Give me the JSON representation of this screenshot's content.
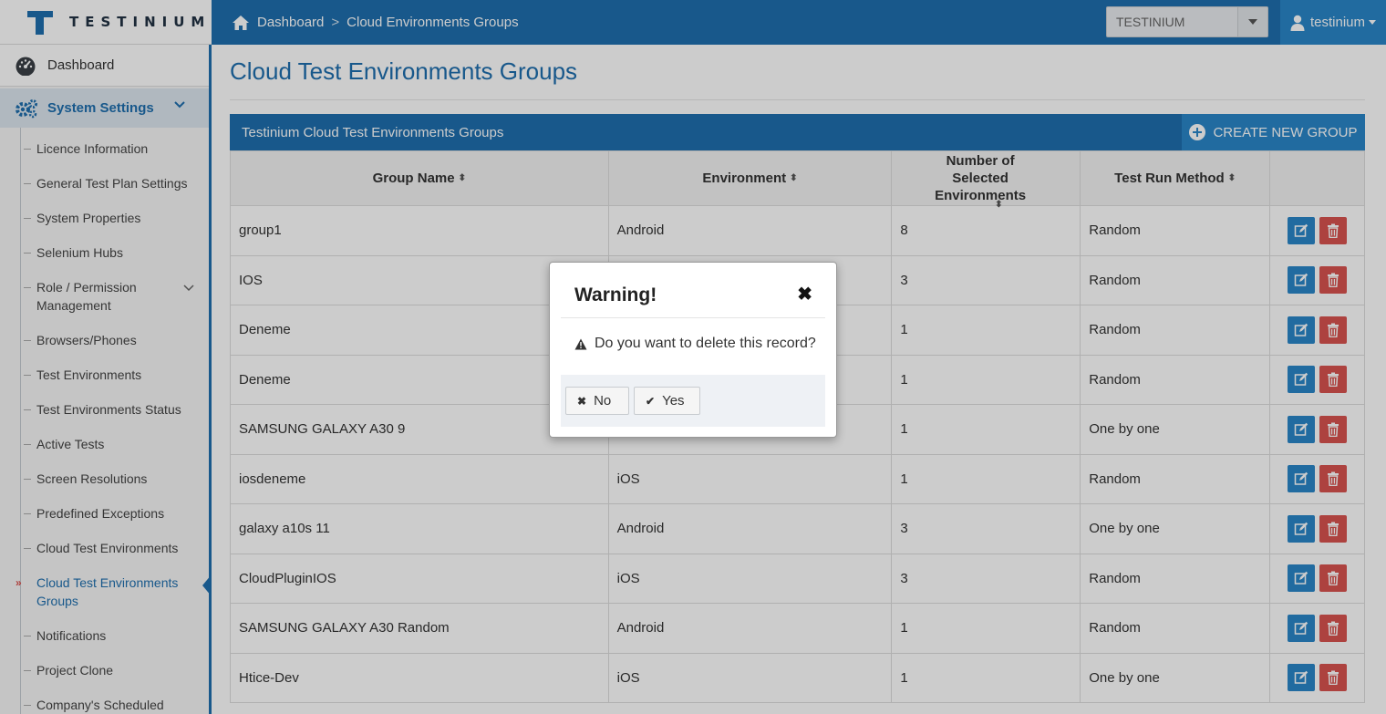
{
  "brand": {
    "name": "TESTINIUM"
  },
  "breadcrumb": {
    "home": "Dashboard",
    "separator": ">",
    "current": "Cloud Environments Groups"
  },
  "project_selector": {
    "value": "TESTINIUM"
  },
  "user": {
    "name": "testinium"
  },
  "sidebar": {
    "dashboard": "Dashboard",
    "section": "System Settings",
    "items": [
      "Licence Information",
      "General Test Plan Settings",
      "System Properties",
      "Selenium Hubs",
      "Role / Permission Management",
      "Browsers/Phones",
      "Test Environments",
      "Test Environments Status",
      "Active Tests",
      "Screen Resolutions",
      "Predefined Exceptions",
      "Cloud Test Environments",
      "Cloud Test Environments Groups",
      "Notifications",
      "Project Clone",
      "Company's Scheduled Plans"
    ],
    "active_index": 12,
    "active_marker": "»"
  },
  "page": {
    "title": "Cloud Test Environments Groups"
  },
  "panel": {
    "title": "Testinium Cloud Test Environments Groups",
    "create_label": "CREATE NEW GROUP"
  },
  "table": {
    "headers": [
      "Group Name",
      "Environment",
      "Number of Selected Environments",
      "Test Run Method"
    ],
    "sort_glyph": "⬍",
    "rows": [
      [
        "group1",
        "Android",
        "8",
        "Random"
      ],
      [
        "IOS",
        "",
        "3",
        "Random"
      ],
      [
        "Deneme",
        "",
        "1",
        "Random"
      ],
      [
        "Deneme",
        "",
        "1",
        "Random"
      ],
      [
        "SAMSUNG GALAXY A30 9",
        "",
        "1",
        "One by one"
      ],
      [
        "iosdeneme",
        "iOS",
        "1",
        "Random"
      ],
      [
        "galaxy a10s 11",
        "Android",
        "3",
        "One by one"
      ],
      [
        "CloudPluginIOS",
        "iOS",
        "3",
        "Random"
      ],
      [
        "SAMSUNG GALAXY A30 Random",
        "Android",
        "1",
        "Random"
      ],
      [
        "Htice-Dev",
        "iOS",
        "1",
        "One by one"
      ]
    ]
  },
  "modal": {
    "title": "Warning!",
    "close": "✖",
    "message": "Do you want to delete this record?",
    "no_label": "No",
    "no_icon": "✖",
    "yes_label": "Yes",
    "yes_icon": "✔"
  },
  "colors": {
    "primary": "#1f6fae",
    "accent": "#2a86c9",
    "danger": "#d9534f"
  }
}
